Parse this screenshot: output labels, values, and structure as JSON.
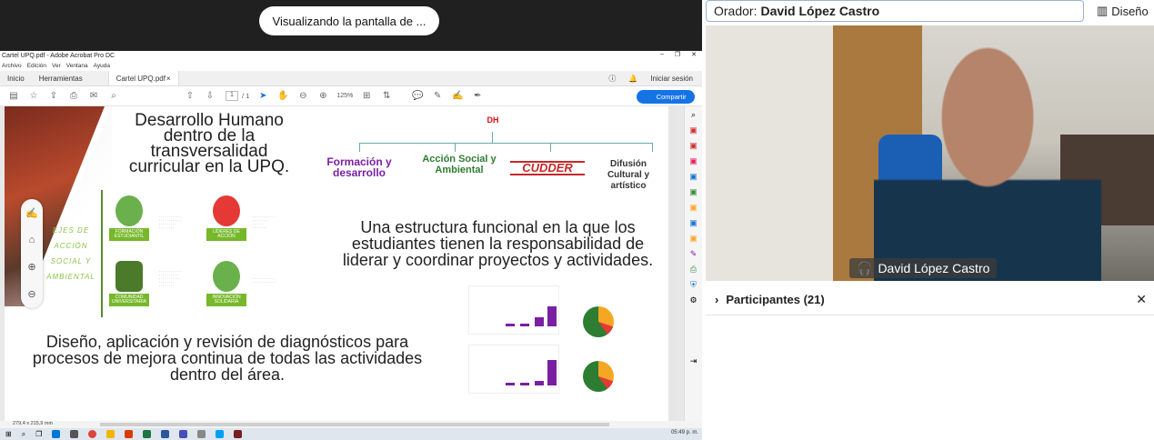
{
  "share": {
    "banner": "Visualizando la pantalla de ..."
  },
  "acrobat": {
    "window_title": "Cartel UPQ.pdf - Adobe Acrobat Pro DC",
    "menu": [
      "Archivo",
      "Edición",
      "Ver",
      "Ventana",
      "Ayuda"
    ],
    "tabs": {
      "home": "Inicio",
      "tools": "Herramientas",
      "doc": "Cartel UPQ.pdf",
      "doc_close": "×"
    },
    "signin": "Iniciar sesión",
    "page_current": "1",
    "page_total": "/ 1",
    "zoom": "125%",
    "share_btn": "Compartir",
    "status_size": "279,4 x 215,9 mm",
    "clock": "05:49 p. m."
  },
  "poster": {
    "title": "Desarrollo Humano dentro de la transversalidad curricular en la UPQ.",
    "structure_text": "Una estructura funcional en la que los estudiantes tienen la responsabilidad de liderar y coordinar proyectos y actividades.",
    "diagnostics_text": "Diseño, aplicación y revisión de diagnósticos para procesos de mejora continua de todas las actividades dentro del área.",
    "logo_dh": "DH",
    "logos": {
      "formacion": "Formación y desarrollo",
      "accion": "Acción Social y Ambiental",
      "cudder": "CUDDER",
      "difusion": "Difusión Cultural y artístico"
    },
    "ejes": "EJES DE ACCIÓN SOCIAL Y AMBIENTAL",
    "badges": {
      "formacion_est": "FORMACIÓN ESTUDIANTIL",
      "lideres": "LÍDERES DE ACCIÓN",
      "comunidad": "COMUNIDAD UNIVERSITARIA",
      "innovacion": "INNOVACIÓN SOLIDARIA"
    }
  },
  "meeting": {
    "speaker_label": "Orador:",
    "speaker_name": "David López Castro",
    "layout_btn": "Diseño",
    "video_name": "David López Castro",
    "participants": "Participantes (21)"
  }
}
